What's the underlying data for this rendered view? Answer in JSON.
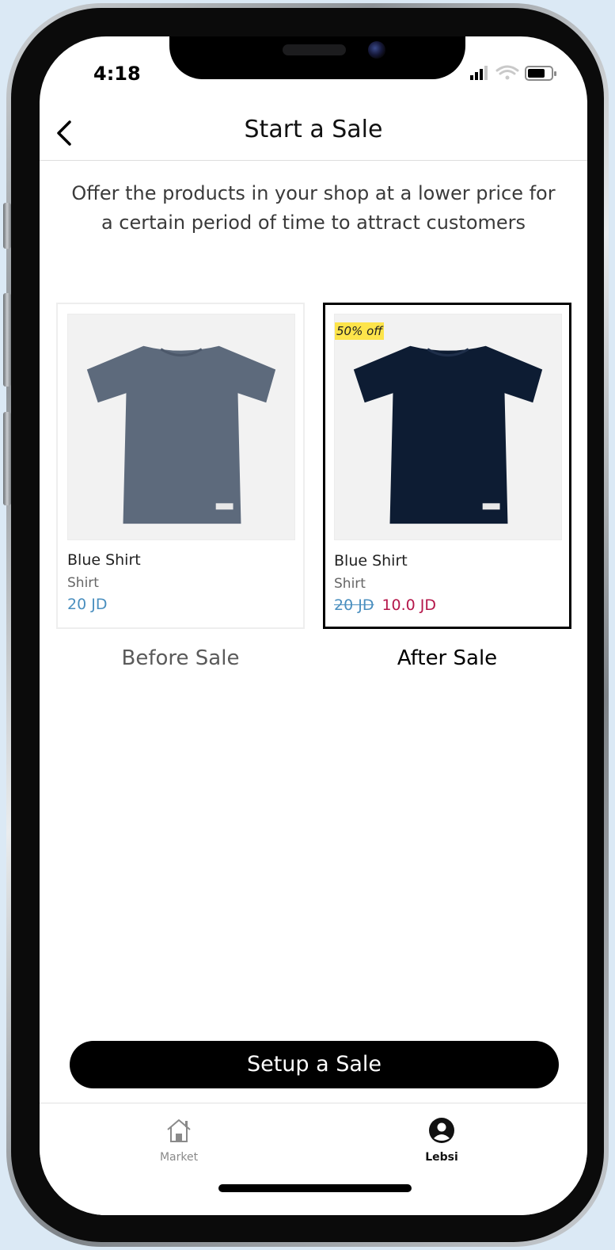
{
  "status_bar": {
    "time": "4:18"
  },
  "header": {
    "title": "Start a Sale"
  },
  "description": "Offer the products in your shop at a lower price for a certain period of time to attract customers",
  "cards": [
    {
      "caption": "Before Sale",
      "product_name": "Blue Shirt",
      "category": "Shirt",
      "price": "20 JD",
      "shirt_color": "#5d6a7c"
    },
    {
      "caption": "After Sale",
      "badge": "50% off",
      "product_name": "Blue Shirt",
      "category": "Shirt",
      "old_price": "20 JD",
      "new_price": "10.0 JD",
      "shirt_color": "#0d1c33"
    }
  ],
  "cta": {
    "label": "Setup a Sale"
  },
  "tabbar": {
    "items": [
      {
        "label": "Market",
        "icon": "home-icon",
        "active": false
      },
      {
        "label": "Lebsi",
        "icon": "profile-icon",
        "active": true
      }
    ]
  },
  "colors": {
    "price_blue": "#4a8fbf",
    "sale_red": "#b5174a",
    "badge_yellow": "#fde44b",
    "accent_black": "#000000"
  }
}
